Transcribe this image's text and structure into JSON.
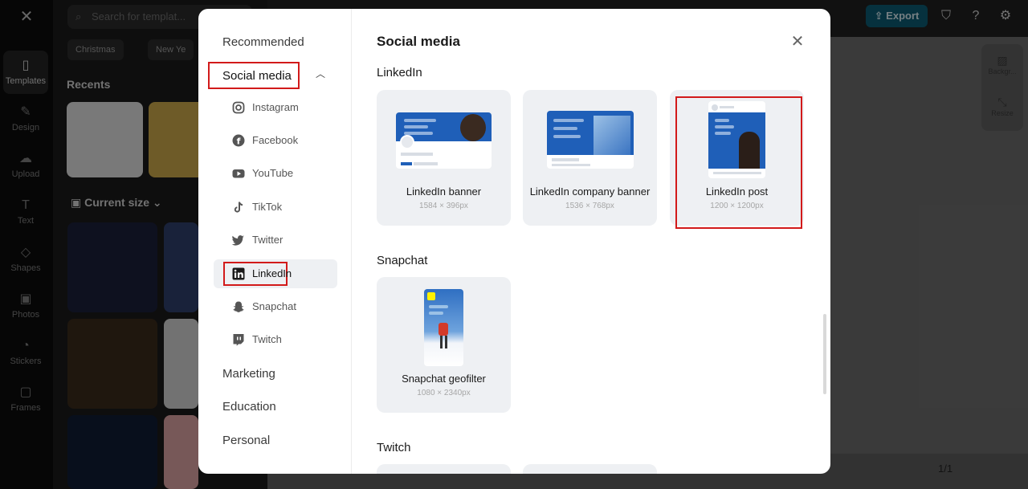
{
  "background_app": {
    "rail": [
      {
        "label": "Templates",
        "icon": "templates-icon",
        "glyph": "▯"
      },
      {
        "label": "Design",
        "icon": "design-icon",
        "glyph": "✎"
      },
      {
        "label": "Upload",
        "icon": "upload-icon",
        "glyph": "☁"
      },
      {
        "label": "Text",
        "icon": "text-icon",
        "glyph": "T"
      },
      {
        "label": "Shapes",
        "icon": "shapes-icon",
        "glyph": "◇"
      },
      {
        "label": "Photos",
        "icon": "photos-icon",
        "glyph": "▣"
      },
      {
        "label": "Stickers",
        "icon": "stickers-icon",
        "glyph": "◔"
      },
      {
        "label": "Frames",
        "icon": "frames-icon",
        "glyph": "▢"
      }
    ],
    "search_placeholder": "Search for templat...",
    "chips": [
      "Christmas",
      "New Ye"
    ],
    "recents_title": "Recents",
    "current_size_label": "Current size",
    "export_label": "Export",
    "right_tools": [
      "Backgr...",
      "Resize"
    ],
    "page_indicator": "1/1"
  },
  "modal": {
    "sidebar": {
      "categories_top": [
        "Recommended"
      ],
      "active_category": "Social media",
      "subcategories": [
        {
          "label": "Instagram",
          "icon": "instagram-icon"
        },
        {
          "label": "Facebook",
          "icon": "facebook-icon"
        },
        {
          "label": "YouTube",
          "icon": "youtube-icon"
        },
        {
          "label": "TikTok",
          "icon": "tiktok-icon"
        },
        {
          "label": "Twitter",
          "icon": "twitter-icon"
        },
        {
          "label": "LinkedIn",
          "icon": "linkedin-icon"
        },
        {
          "label": "Snapchat",
          "icon": "snapchat-icon"
        },
        {
          "label": "Twitch",
          "icon": "twitch-icon"
        }
      ],
      "active_subcategory": "LinkedIn",
      "categories_bottom": [
        "Marketing",
        "Education",
        "Personal"
      ]
    },
    "title": "Social media",
    "sections": [
      {
        "name": "LinkedIn",
        "cards": [
          {
            "name": "LinkedIn banner",
            "size": "1584 × 396px"
          },
          {
            "name": "LinkedIn company banner",
            "size": "1536 × 768px"
          },
          {
            "name": "LinkedIn post",
            "size": "1200 × 1200px",
            "selected": true
          }
        ]
      },
      {
        "name": "Snapchat",
        "cards": [
          {
            "name": "Snapchat geofilter",
            "size": "1080 × 2340px"
          }
        ]
      },
      {
        "name": "Twitch",
        "cards": []
      }
    ],
    "colors": {
      "highlight": "#d21a1a",
      "card_bg": "#eef0f3",
      "linkedin_blue": "#1f5fb8"
    }
  }
}
